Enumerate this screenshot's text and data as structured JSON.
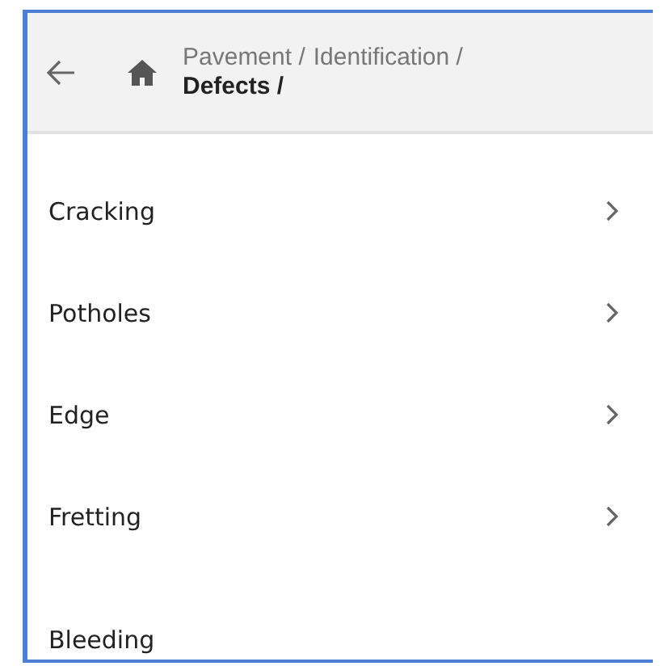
{
  "header": {
    "breadcrumb": [
      {
        "label": "Pavement /",
        "current": false
      },
      {
        "label": "Identification /",
        "current": false
      },
      {
        "label": "Defects /",
        "current": true
      }
    ]
  },
  "items": [
    {
      "label": "Cracking",
      "has_children": true
    },
    {
      "label": "Potholes",
      "has_children": true
    },
    {
      "label": "Edge",
      "has_children": true
    },
    {
      "label": "Fretting",
      "has_children": true
    },
    {
      "label": "Bleeding",
      "has_children": false
    }
  ]
}
